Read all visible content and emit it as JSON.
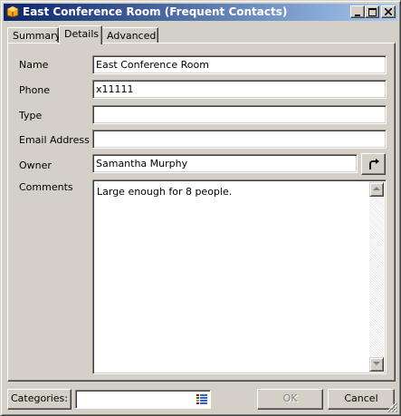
{
  "window": {
    "title": "East Conference Room (Frequent Contacts)",
    "controls": [
      "minimize",
      "maximize",
      "close"
    ]
  },
  "tabs": [
    {
      "label": "Summary",
      "active": false
    },
    {
      "label": "Details",
      "active": true
    },
    {
      "label": "Advanced",
      "active": false
    }
  ],
  "form": {
    "name_label": "Name",
    "name_value": "East Conference Room",
    "phone_label": "Phone",
    "phone_value": "x11111",
    "type_label": "Type",
    "type_value": "",
    "email_label": "Email Address",
    "email_value": "",
    "owner_label": "Owner",
    "owner_value": "Samantha Murphy",
    "comments_label": "Comments",
    "comments_value": "Large enough for 8 people."
  },
  "footer": {
    "categories_label": "Categories:",
    "categories_value": "",
    "ok_label": "OK",
    "ok_enabled": false,
    "cancel_label": "Cancel"
  },
  "icons": {
    "app": "contact-resource-icon",
    "owner_button": "redirect-arrow-icon",
    "categories": "category-list-icon"
  }
}
